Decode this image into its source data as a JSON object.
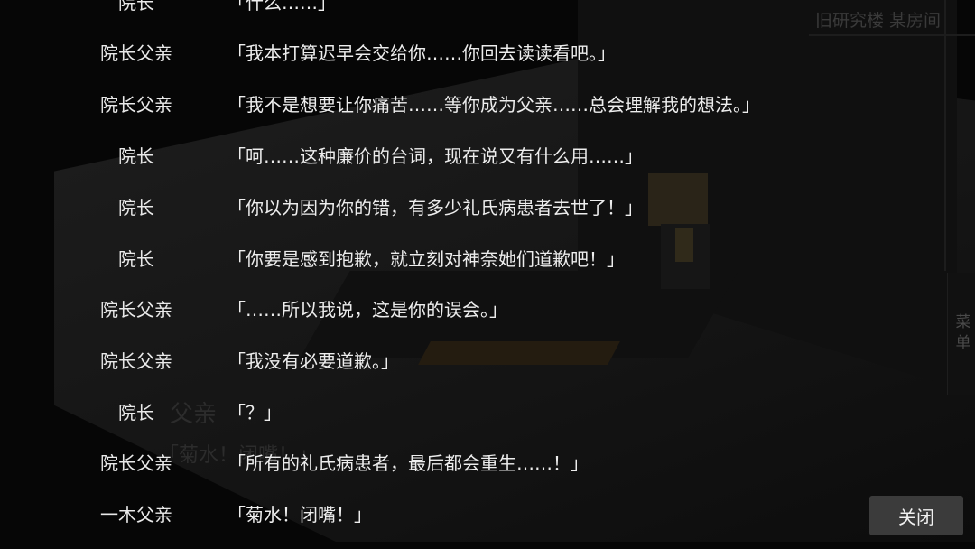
{
  "scene": {
    "location": "旧研究楼 某房间",
    "ghost_name": "父亲",
    "ghost_line": "「菊水！闭嘴！」"
  },
  "menu_label": "菜单",
  "backlog": [
    {
      "speaker": "院长",
      "text": "「什么……」"
    },
    {
      "speaker": "院长父亲",
      "text": "「我本打算迟早会交给你……你回去读读看吧。」"
    },
    {
      "speaker": "院长父亲",
      "text": "「我不是想要让你痛苦……等你成为父亲……总会理解我的想法。」"
    },
    {
      "speaker": "院长",
      "text": "「呵……这种廉价的台词，现在说又有什么用……」"
    },
    {
      "speaker": "院长",
      "text": "「你以为因为你的错，有多少礼氏病患者去世了！」"
    },
    {
      "speaker": "院长",
      "text": "「你要是感到抱歉，就立刻对神奈她们道歉吧！」"
    },
    {
      "speaker": "院长父亲",
      "text": "「……所以我说，这是你的误会。」"
    },
    {
      "speaker": "院长父亲",
      "text": "「我没有必要道歉。」"
    },
    {
      "speaker": "院长",
      "text": "「？」"
    },
    {
      "speaker": "院长父亲",
      "text": "「所有的礼氏病患者，最后都会重生……！」"
    },
    {
      "speaker": "一木父亲",
      "text": "「菊水！闭嘴！」"
    }
  ],
  "close_label": "关闭"
}
